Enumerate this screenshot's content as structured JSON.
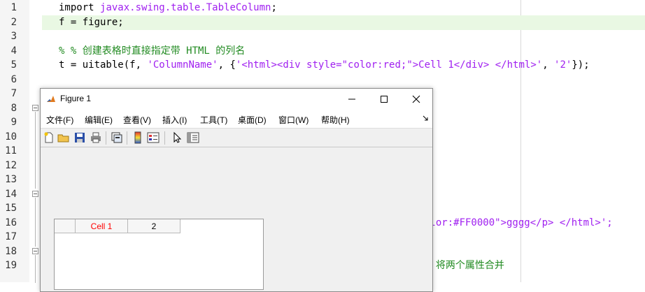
{
  "editor": {
    "line_numbers": [
      "1",
      "2",
      "3",
      "4",
      "5",
      "6",
      "7",
      "8",
      "9",
      "10",
      "11",
      "12",
      "13",
      "14",
      "15",
      "16",
      "17",
      "18",
      "19"
    ],
    "lines": {
      "l1_a": "import ",
      "l1_b": "javax.swing.table.TableColumn",
      "l1_c": ";",
      "l2": "f = figure;",
      "l4": "% % 创建表格时直接指定带 HTML 的列名",
      "l5_a": "t = uitable(f, ",
      "l5_b": "'ColumnName'",
      "l5_c": ", {",
      "l5_d": "'<html><div style=\"color:red;\">Cell 1</div> </html>'",
      "l5_e": ", ",
      "l5_f": "'2'",
      "l5_g": "});",
      "l16_frag": "olor:#FF0000\">gggg</p> </html>';",
      "l19_frag": "% 将两个属性合并"
    }
  },
  "figure": {
    "title": "Figure 1",
    "menus": [
      "文件(F)",
      "编辑(E)",
      "查看(V)",
      "插入(I)",
      "工具(T)",
      "桌面(D)",
      "窗口(W)",
      "帮助(H)"
    ],
    "toolbar_icons": [
      "new-file-icon",
      "open-folder-icon",
      "save-icon",
      "print-icon",
      "link-icon",
      "colorbar-icon",
      "legend-icon",
      "pointer-icon",
      "property-inspector-icon"
    ],
    "table": {
      "columns": [
        "Cell 1",
        "2"
      ],
      "column_colors": [
        "#ff0000",
        "#000000"
      ]
    }
  }
}
